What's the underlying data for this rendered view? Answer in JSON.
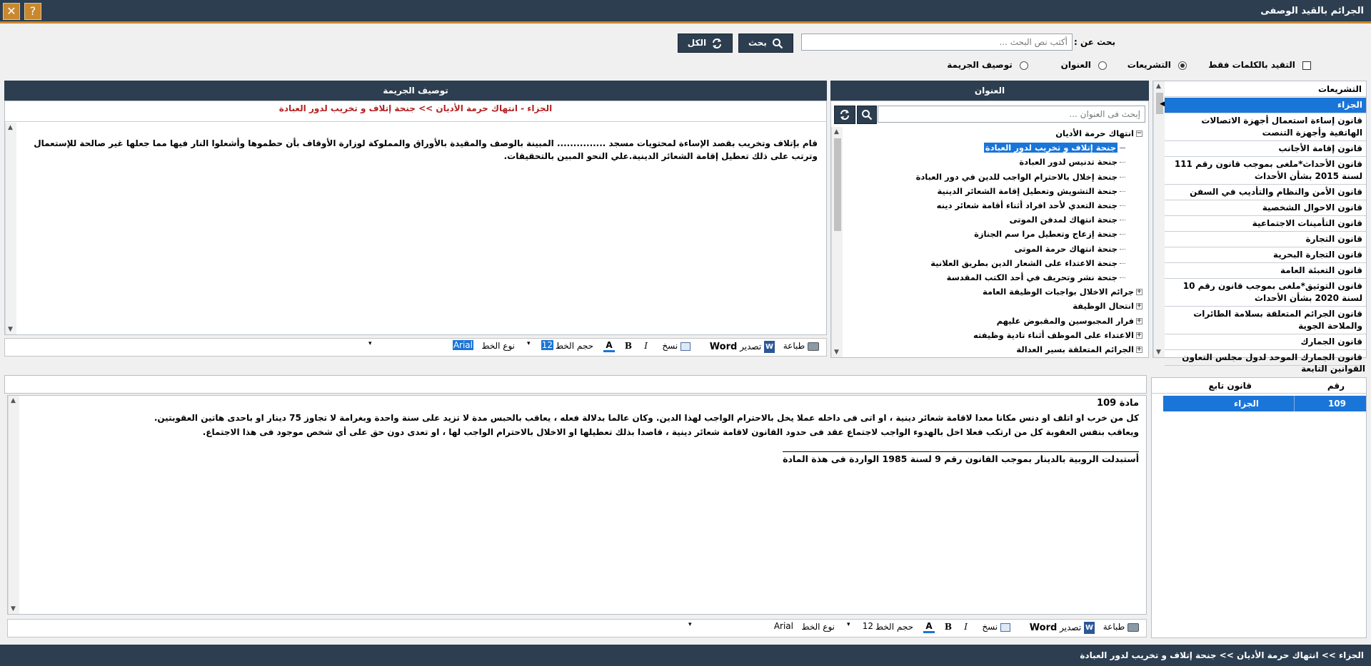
{
  "window": {
    "title": "الجرائم بالقيد الوصفى",
    "help_glyph": "?",
    "close_glyph": "✕"
  },
  "search": {
    "label": "بحث عن :",
    "placeholder": "أكتب نص البحث ...",
    "search_button": "بحث",
    "all_button": "الكل"
  },
  "options": {
    "exact_words": "التقيد بالكلمات فقط",
    "scope_laws": "التشريعات",
    "scope_title": "العنوان",
    "scope_description": "توصيف الجريمة",
    "selected_scope": "التشريعات"
  },
  "laws_panel": {
    "header": "التشريعات",
    "items": [
      "الجزاء",
      "قانون إساءة استعمال أجهزة الاتصالات الهاتفية وأجهزة التنصت",
      "قانون إقامة الأجانب",
      "قانون الأحداث*ملغى بموجب قانون رقم 111 لسنة 2015 بشأن الأحداث",
      "قانون الأمن والنظام والتأديب في السفن",
      "قانون الاحوال الشخصية",
      "قانون التأمينات الاجتماعية",
      "قانون التجارة",
      "قانون التجارة البحرية",
      "قانون التعبئة العامة",
      "قانون التوثيق*ملغى بموجب قانون رقم 10 لسنة 2020 بشأن الأحداث",
      "قانون الجرائم المتعلقة بسلامة الطائرات والملاحة الجوية",
      "قانون الجمارك",
      "قانون الجمارك الموحد لدول مجلس التعاون"
    ]
  },
  "title_panel": {
    "header": "العنوان",
    "search_placeholder": "إبحث فى العنوان ...",
    "tree": [
      {
        "label": "انتهاك حرمة الأديان",
        "expander": "−"
      },
      {
        "label": "جنحة إتلاف و تخريب لدور العبادة",
        "selected": true
      },
      {
        "label": "جنحة تدنيس لدور العبادة"
      },
      {
        "label": "جنحة إخلال بالاحترام الواجب للدين في دور العبادة"
      },
      {
        "label": "جنحة التشويش وتعطيل إقامة الشعائر الدينية"
      },
      {
        "label": "جنحة التعدي لأحد افراد أثناء أقامة شعائر دينه"
      },
      {
        "label": "جنحة انتهاك لمدفن الموتى"
      },
      {
        "label": "جنحة إزعاج وتعطيل مرا سم الجنازة"
      },
      {
        "label": "جنحة انتهاك حرمة الموتى"
      },
      {
        "label": "جنحة الاعتداء على الشعار الدين بطريق العلانية"
      },
      {
        "label": "جنحة نشر وتحريف في أحد الكتب المقدسة"
      },
      {
        "label": "جرائم الاخلال بواجبات الوظيفة العامة",
        "expander": "+"
      },
      {
        "label": "انتحال الوظيفة",
        "expander": "+"
      },
      {
        "label": "فرار المجبوسين والمقبوض عليهم",
        "expander": "+"
      },
      {
        "label": "الاعتداء على الموظف أثناء تادية وظيفته",
        "expander": "+"
      },
      {
        "label": "الجرائم المتعلقة بسير العدالة",
        "expander": "+"
      }
    ]
  },
  "description_panel": {
    "header": "توصيف الجريمة",
    "breadcrumb": "الجزاء - انتهاك حرمة الأديان >> جنحة إتلاف و تخريب لدور العبادة",
    "text": "قام بإتلاف وتخريب بقصد الإساءة لمحتويات مسجد ............... المبينة بالوصف والمقيدة بالأوراق والمملوكة لوزارة الأوقاف بأن حطموها وأشعلوا النار فيها مما جعلها غير صالحة للإستعمال وترتب على ذلك تعطيل إقامة الشعائر الدينية.علي النحو المبين بالتحقيقات."
  },
  "editor_toolbar": {
    "print": "طباعة",
    "export": "تصدير",
    "word": "Word",
    "copy": "نسخ",
    "bold": "B",
    "italic": "I",
    "font_size_label": "حجم الخط",
    "font_size_value": "12",
    "font_type_label": "نوع الخط",
    "font_type_value": "Arial",
    "dropdown_glyph": "▾"
  },
  "following_laws": {
    "label": "القوانين التابعة",
    "col_number": "رقم",
    "col_law": "قانون تابع",
    "rows": [
      {
        "number": "109",
        "law": "الجزاء"
      }
    ]
  },
  "article": {
    "title": "مادة 109",
    "line1": "كل من خرب او اتلف او دنس مكانا معدا لاقامة شعائر دينية ، او اتى فى داخله عملا يخل بالاحترام الواجب لهذا الدين. وكان عالما بدلالة فعله ، يعاقب بالحبس مدة لا تزيد على سنة واحدة وبغرامة لا تجاوز 75 دينار او باحدى هاتين العقوبتين.",
    "line2": "ويعاقب بنفس العقوبة كل من ارتكب فعلا اخل بالهدوء الواجب لاجتماع عقد فى حدود القانون لاقامة شعائر دينية ، قاصدا بذلك تعطيلها او الاخلال بالاحترام الواجب لها ، او تعدى دون حق على أي شخص موجود فى هذا الاجتماع.",
    "note": "أستبدلت الروبية بالدينار  بموجب القانون رقم 9 لسنة  1985 الواردة فى هذة المادة"
  },
  "status_bar": {
    "text": "الجزاء >> انتهاك حرمة الأديان >> جنحة إتلاف و تخريب لدور العبادة"
  },
  "colors": {
    "dark_blue": "#2c3e50",
    "accent_orange": "#c9882e",
    "selection_blue": "#1a75d8",
    "breadcrumb_red": "#b22222"
  }
}
